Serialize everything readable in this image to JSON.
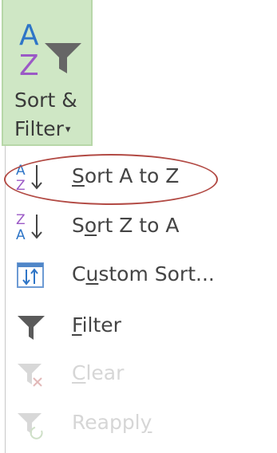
{
  "ribbon": {
    "button_line1": "Sort &",
    "button_line2": "Filter",
    "icon": "sort-filter-icon",
    "dropdown_caret": "▾"
  },
  "menu": {
    "items": [
      {
        "pre": "",
        "ul": "S",
        "post": "ort A to Z",
        "icon": "sort-a-to-z-icon",
        "enabled": true
      },
      {
        "pre": "S",
        "ul": "o",
        "post": "rt Z to A",
        "icon": "sort-z-to-a-icon",
        "enabled": true
      },
      {
        "pre": "C",
        "ul": "u",
        "post": "stom Sort...",
        "icon": "custom-sort-icon",
        "enabled": true
      },
      {
        "pre": "",
        "ul": "F",
        "post": "ilter",
        "icon": "filter-icon",
        "enabled": true
      },
      {
        "pre": "",
        "ul": "C",
        "post": "lear",
        "icon": "clear-filter-icon",
        "enabled": false
      },
      {
        "pre": "Reappl",
        "ul": "y",
        "post": "",
        "icon": "reapply-filter-icon",
        "enabled": false
      }
    ]
  },
  "colors": {
    "ribbon_bg": "#cfe7c5",
    "highlight": "#b24a44",
    "a_blue": "#2e75c7",
    "z_purple": "#9b59c6"
  }
}
